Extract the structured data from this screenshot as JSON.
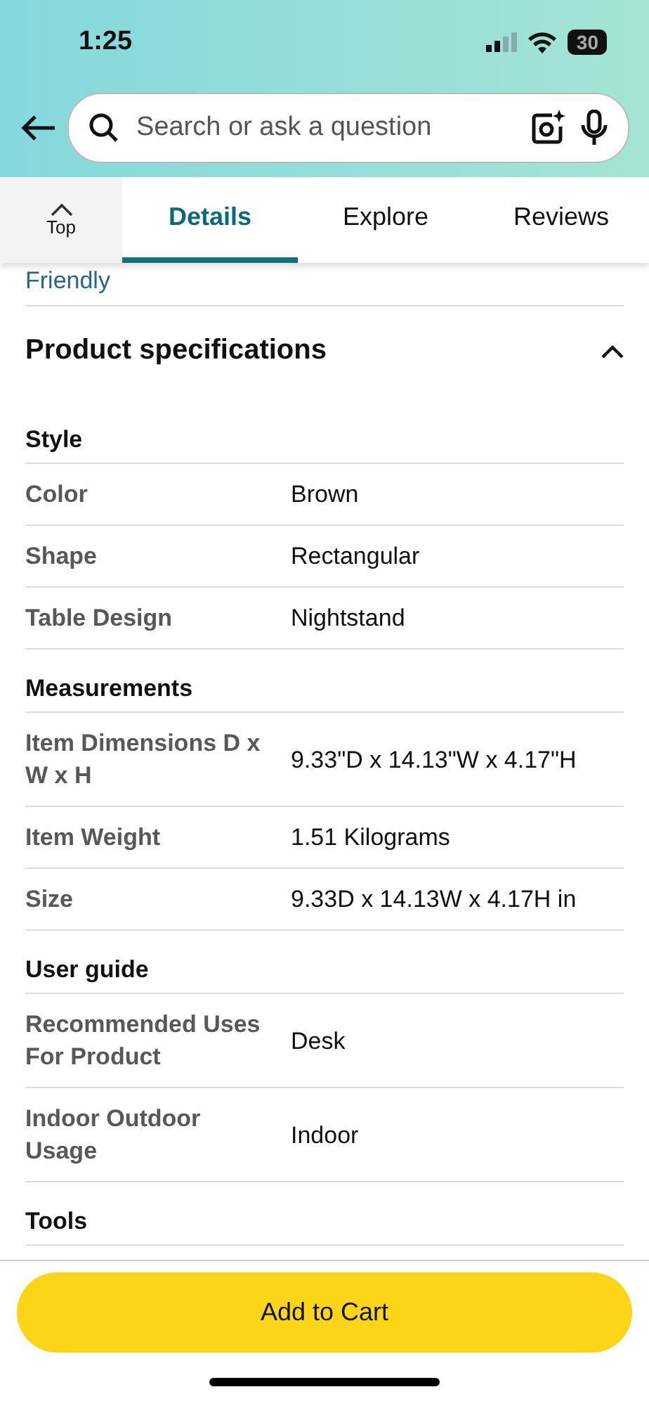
{
  "status_bar": {
    "time": "1:25",
    "battery": "30"
  },
  "search": {
    "placeholder": "Search or ask a question"
  },
  "tabs": [
    {
      "label": "Top",
      "kind": "scroll-top",
      "selected": false
    },
    {
      "label": "Details",
      "kind": "tab",
      "selected": true
    },
    {
      "label": "Explore",
      "kind": "tab",
      "selected": false
    },
    {
      "label": "Reviews",
      "kind": "tab",
      "selected": false
    }
  ],
  "previous_link": "Friendly",
  "specifications": {
    "title": "Product specifications",
    "expanded": true,
    "sections": [
      {
        "heading": "Style",
        "rows": [
          {
            "label": "Color",
            "value": "Brown"
          },
          {
            "label": "Shape",
            "value": "Rectangular"
          },
          {
            "label": "Table Design",
            "value": "Nightstand"
          }
        ]
      },
      {
        "heading": "Measurements",
        "rows": [
          {
            "label": "Item Dimensions D x W x H",
            "value": "9.33\"D x 14.13\"W x 4.17\"H"
          },
          {
            "label": "Item Weight",
            "value": "1.51 Kilograms"
          },
          {
            "label": "Size",
            "value": "9.33D x 14.13W x 4.17H in"
          }
        ]
      },
      {
        "heading": "User guide",
        "rows": [
          {
            "label": "Recommended Uses For Product",
            "value": "Desk"
          },
          {
            "label": "Indoor Outdoor Usage",
            "value": "Indoor"
          }
        ]
      },
      {
        "heading": "Tools"
      }
    ]
  },
  "add_to_cart": "Add to Cart"
}
